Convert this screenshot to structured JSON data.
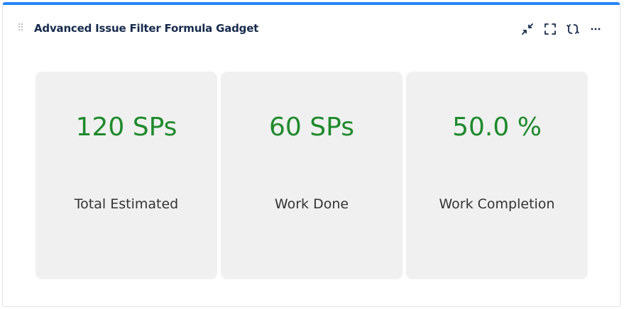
{
  "gadget": {
    "title": "Advanced Issue Filter Formula Gadget",
    "accent_color": "#2684ff",
    "actions": [
      {
        "name": "minimize",
        "icon": "minimize-icon"
      },
      {
        "name": "maximize",
        "icon": "maximize-icon"
      },
      {
        "name": "refresh",
        "icon": "refresh-icon"
      },
      {
        "name": "more",
        "icon": "more-icon"
      }
    ]
  },
  "cards": [
    {
      "value": "120 SPs",
      "label": "Total Estimated"
    },
    {
      "value": "60 SPs",
      "label": "Work Done"
    },
    {
      "value": "50.0 %",
      "label": "Work Completion"
    }
  ],
  "colors": {
    "value": "#1e8a2c",
    "card_background": "#f0f0f0",
    "title": "#172b4d"
  }
}
